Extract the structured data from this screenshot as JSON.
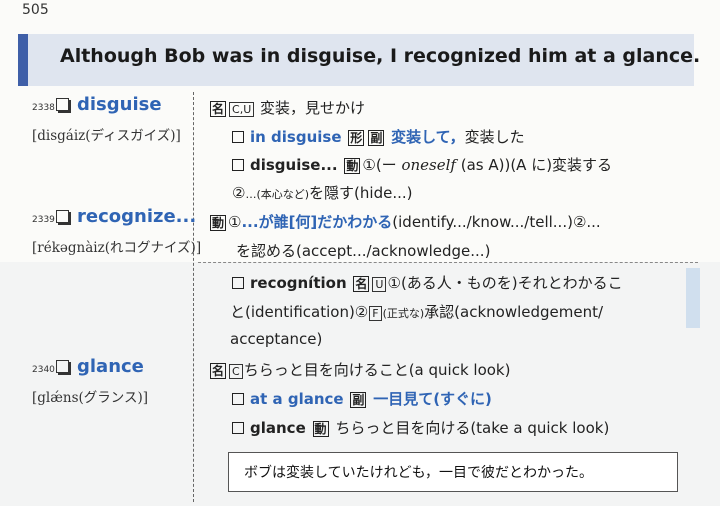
{
  "page_number": "505",
  "banner": {
    "sentence": "Although Bob was in disguise, I recognized him at a glance."
  },
  "entries": {
    "disguise": {
      "num": "2338",
      "headword": "disguise",
      "pron": "[disgáiz(ディスガイズ)]",
      "l1": {
        "pos": "名",
        "tags": "C,U",
        "text": "変装，見せかけ"
      },
      "l2": {
        "phrase": "in disguise",
        "pos1": "形",
        "pos2": "副",
        "meaning": "変装して，",
        "rest": "変装した"
      },
      "l3": {
        "word": "disguise...",
        "pos": "動",
        "circled": "①",
        "dash": "(ー",
        "oneself": "oneself",
        "paren": "(as A))",
        "rest": "(A に)変装する"
      },
      "l4": {
        "circled": "②",
        "small": "…(本心など)",
        "rest": "を隠す(hide...)"
      }
    },
    "recognize": {
      "num": "2339",
      "headword": "recognize...",
      "pron": "[rékəgnàiz(れコグナイズ)]",
      "l1": {
        "pos": "動",
        "circled": "①",
        "meaning": "...が誰[何]だかわかる",
        "rest": "(identify.../know.../tell...)②...",
        "wrap": "を認める(accept.../acknowledge...)"
      },
      "l2": {
        "word": "recognítion",
        "pos": "名",
        "tag": "U",
        "circled": "①",
        "text": "(ある人・ものを)それとわかるこ",
        "wrap1": "と(identification)②",
        "tag2": "F",
        "small": "(正式な)",
        "wrap2": "承認(acknowledgement/",
        "wrap3": "acceptance)"
      }
    },
    "glance": {
      "num": "2340",
      "headword": "glance",
      "pron": "[glǽns(グランス)]",
      "l1": {
        "pos": "名",
        "tag": "C",
        "text": "ちらっと目を向けること(a quick look)"
      },
      "l2": {
        "phrase": "at a glance",
        "pos": "副",
        "meaning": "一目見て(すぐに)"
      },
      "l3": {
        "word": "glance",
        "pos": "動",
        "text": "ちらっと目を向ける(take a quick look)"
      }
    }
  },
  "answer": "ボブは変装していたけれども，一目で彼だとわかった。"
}
